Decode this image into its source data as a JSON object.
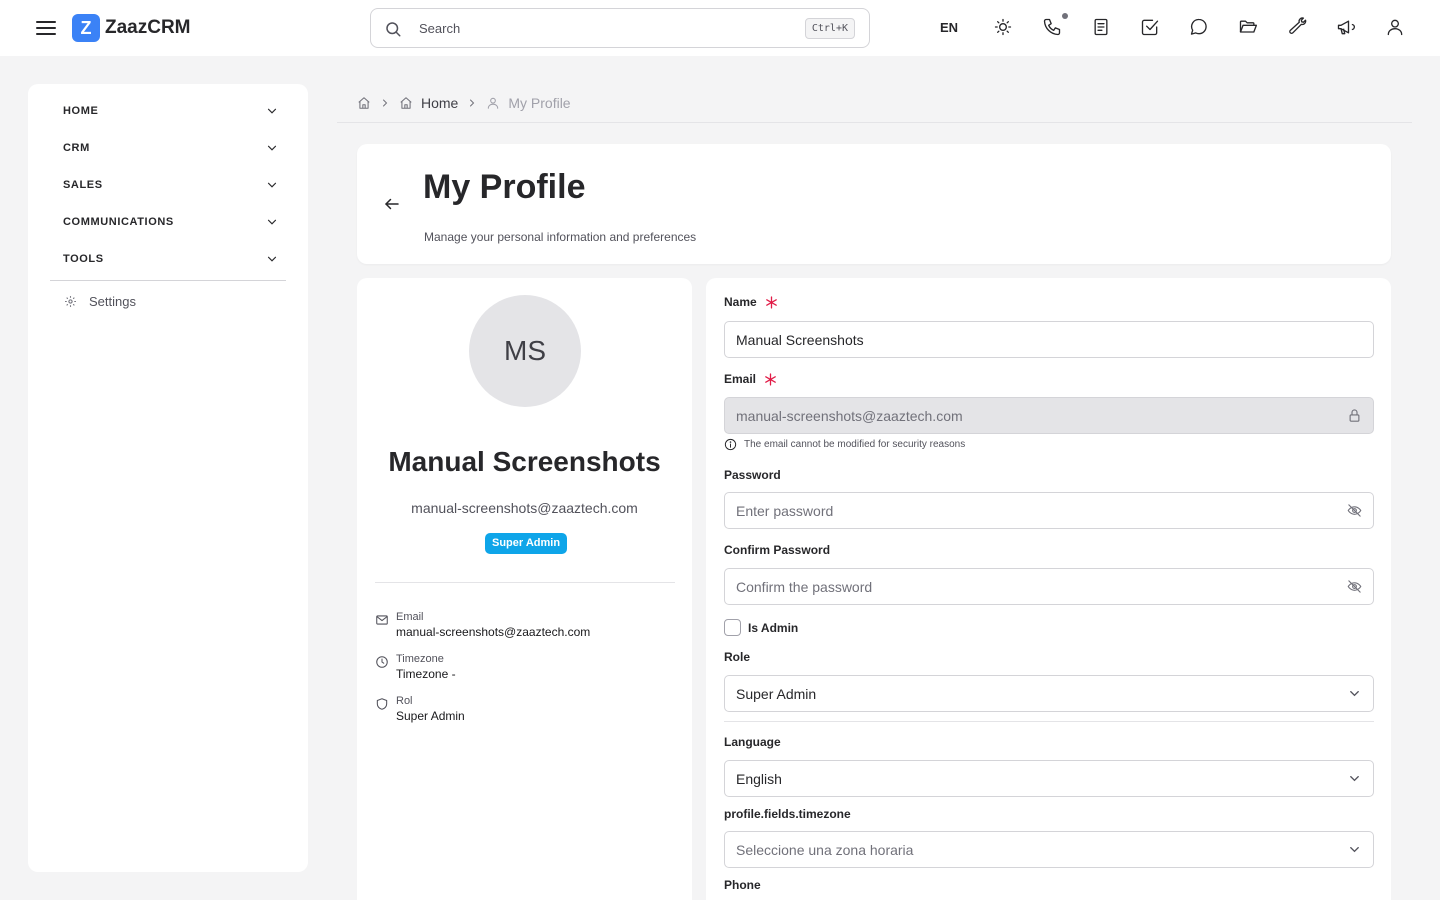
{
  "app": {
    "logo_letter": "Z",
    "name": "ZaazCRM"
  },
  "header": {
    "search_placeholder": "Search",
    "search_shortcut": "Ctrl+K",
    "language": "EN",
    "icons": [
      "sun-icon",
      "phone-icon",
      "notes-icon",
      "task-check-icon",
      "chat-icon",
      "folder-open-icon",
      "wrench-icon",
      "megaphone-icon",
      "user-icon"
    ]
  },
  "sidebar": {
    "items": [
      {
        "label": "HOME"
      },
      {
        "label": "CRM"
      },
      {
        "label": "SALES"
      },
      {
        "label": "COMMUNICATIONS"
      },
      {
        "label": "TOOLS"
      }
    ],
    "settings_label": "Settings"
  },
  "breadcrumb": {
    "home": "Home",
    "current": "My Profile"
  },
  "page": {
    "title": "My Profile",
    "subtitle": "Manage your personal information and preferences"
  },
  "profile": {
    "initials": "MS",
    "name": "Manual Screenshots",
    "email": "manual-screenshots@zaaztech.com",
    "role_badge": "Super Admin",
    "info": [
      {
        "key": "Email",
        "value": "manual-screenshots@zaaztech.com"
      },
      {
        "key": "Timezone",
        "value": "Timezone -"
      },
      {
        "key": "Rol",
        "value": "Super Admin"
      }
    ]
  },
  "form": {
    "name_label": "Name",
    "name_value": "Manual Screenshots",
    "email_label": "Email",
    "email_value": "manual-screenshots@zaaztech.com",
    "email_hint": "The email cannot be modified for security reasons",
    "password_label": "Password",
    "password_placeholder": "Enter password",
    "confirm_label": "Confirm Password",
    "confirm_placeholder": "Confirm the password",
    "is_admin_label": "Is Admin",
    "is_admin_checked": false,
    "role_label": "Role",
    "role_value": "Super Admin",
    "language_label": "Language",
    "language_value": "English",
    "timezone_label": "profile.fields.timezone",
    "timezone_placeholder": "Seleccione una zona horaria",
    "phone_label": "Phone"
  },
  "colors": {
    "brand": "#3b82f6",
    "badge": "#0ea5e9",
    "required": "#e11d48"
  }
}
